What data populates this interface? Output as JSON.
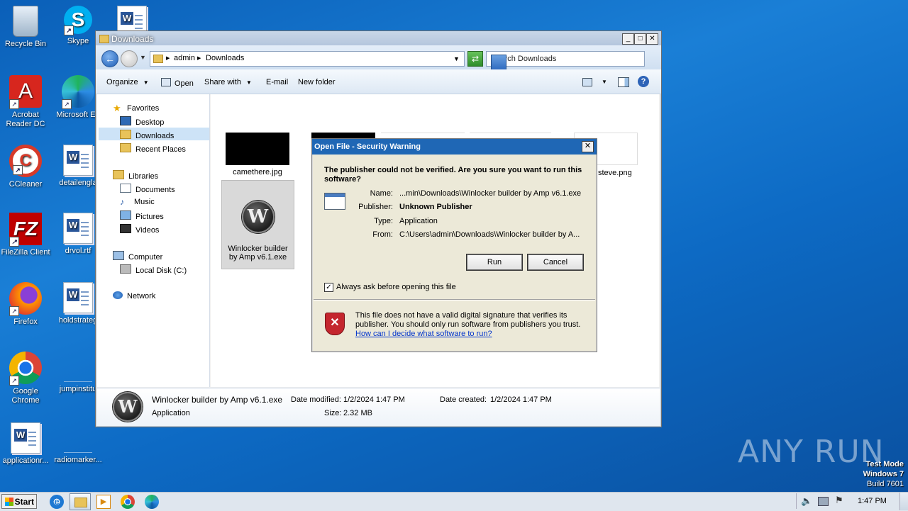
{
  "desktop": {
    "icons": [
      {
        "label": "Recycle Bin"
      },
      {
        "label": "Skype"
      },
      {
        "label": "Acrobat Reader DC"
      },
      {
        "label": "Microsoft Ed"
      },
      {
        "label": "CCleaner"
      },
      {
        "label": "detailengla"
      },
      {
        "label": "FileZilla Client"
      },
      {
        "label": "drvol.rtf"
      },
      {
        "label": "Firefox"
      },
      {
        "label": "holdstrateg"
      },
      {
        "label": "Google Chrome"
      },
      {
        "label": "jumpinstitu"
      },
      {
        "label": "applicationr..."
      },
      {
        "label": "radiomarker..."
      }
    ],
    "watermark": "ANY RUN",
    "os_info": {
      "line1": "Test Mode",
      "line2": "Windows 7",
      "line3": "Build 7601"
    }
  },
  "explorer": {
    "title": "Downloads",
    "breadcrumb": [
      "admin",
      "Downloads"
    ],
    "search_placeholder": "Search Downloads",
    "toolbar": {
      "organize": "Organize",
      "open": "Open",
      "share_with": "Share with",
      "email": "E-mail",
      "new_folder": "New folder"
    },
    "nav": {
      "favorites": "Favorites",
      "desktop": "Desktop",
      "downloads": "Downloads",
      "recent": "Recent Places",
      "libraries": "Libraries",
      "documents": "Documents",
      "music": "Music",
      "pictures": "Pictures",
      "videos": "Videos",
      "computer": "Computer",
      "local_disk": "Local Disk (C:)",
      "network": "Network"
    },
    "files": [
      {
        "name": "camethere.jpg"
      },
      {
        "name": "steve.png"
      },
      {
        "name": "Winlocker builder by Amp v6.1.exe"
      }
    ],
    "details": {
      "name": "Winlocker builder by Amp v6.1.exe",
      "type": "Application",
      "date_modified_label": "Date modified:",
      "date_modified": "1/2/2024 1:47 PM",
      "size_label": "Size:",
      "size": "2.32 MB",
      "date_created_label": "Date created:",
      "date_created": "1/2/2024 1:47 PM"
    }
  },
  "dialog": {
    "title": "Open File - Security Warning",
    "question": "The publisher could not be verified.  Are you sure you want to run this software?",
    "name_label": "Name:",
    "name": "...min\\Downloads\\Winlocker builder by Amp v6.1.exe",
    "publisher_label": "Publisher:",
    "publisher": "Unknown Publisher",
    "type_label": "Type:",
    "type": "Application",
    "from_label": "From:",
    "from": "C:\\Users\\admin\\Downloads\\Winlocker builder by A...",
    "run": "Run",
    "cancel": "Cancel",
    "always_ask": "Always ask before opening this file",
    "always_ask_checked": true,
    "warning_text": "This file does not have a valid digital signature that verifies its publisher.  You should only run software from publishers you trust.",
    "help_link": "How can I decide what software to run?"
  },
  "taskbar": {
    "start": "Start",
    "clock": "1:47 PM"
  }
}
